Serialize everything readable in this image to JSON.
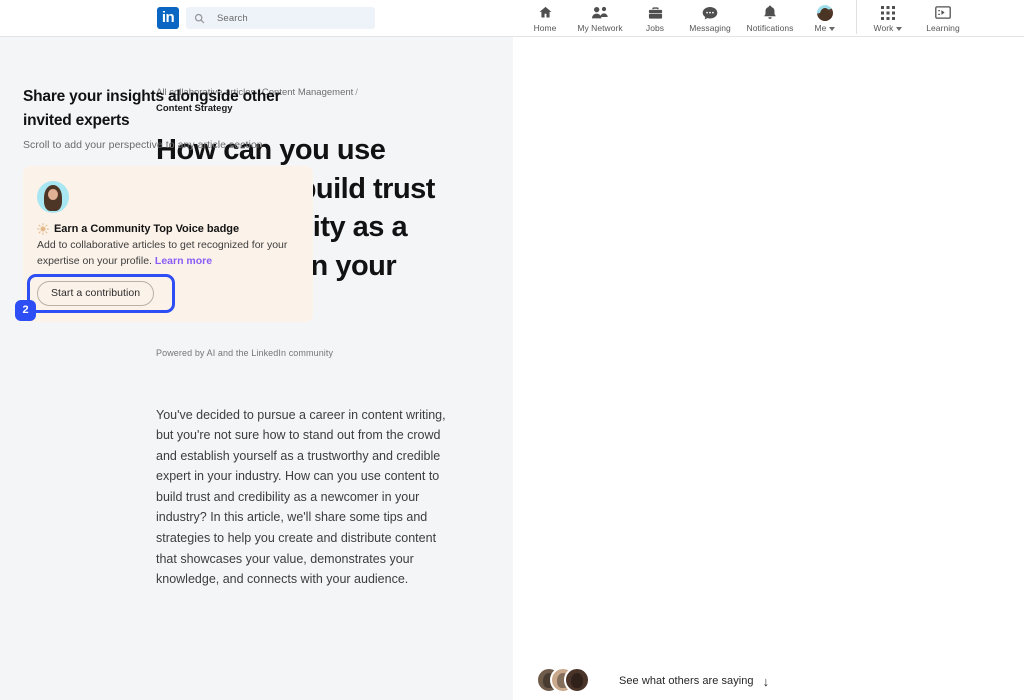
{
  "nav": {
    "logo": "in",
    "search_placeholder": "Search",
    "items": [
      {
        "label": "Home",
        "icon": "home-icon"
      },
      {
        "label": "My Network",
        "icon": "network-icon"
      },
      {
        "label": "Jobs",
        "icon": "briefcase-icon"
      },
      {
        "label": "Messaging",
        "icon": "message-icon"
      },
      {
        "label": "Notifications",
        "icon": "bell-icon"
      },
      {
        "label": "Me",
        "icon": "avatar-icon"
      }
    ],
    "right_items": [
      {
        "label": "Work",
        "icon": "grid-icon"
      },
      {
        "label": "Learning",
        "icon": "learning-icon"
      }
    ]
  },
  "article": {
    "breadcrumb": {
      "items": [
        "All collaborative articles",
        "Content Management"
      ],
      "separator": "/",
      "current": "Content Strategy"
    },
    "headline": "How can you use content to build trust and credibility as a newcomer in your industry?",
    "powered_by": "Powered by AI and the LinkedIn community",
    "body": "You've decided to pursue a career in content writing, but you're not sure how to stand out from the crowd and establish yourself as a trustworthy and credible expert in your industry. How can you use content to build trust and credibility as a newcomer in your industry? In this article, we'll share some tips and strategies to help you create and distribute content that showcases your value, demonstrates your knowledge, and connects with your audience."
  },
  "right_panel": {
    "title": "Share your insights alongside other invited experts",
    "subtitle": "Scroll to add your perspective to any article section",
    "promo": {
      "badge_icon": "sun-badge-icon",
      "badge_title": "Earn a Community Top Voice badge",
      "description": "Add to collaborative articles to get recognized for your expertise on your profile. ",
      "learn_more": "Learn more",
      "cta_label": "Start a contribution",
      "step_number": "2",
      "background_color": "#fbf2e9",
      "highlight_color": "#2d4df5",
      "link_color": "#8a5cf6"
    },
    "footer": {
      "see_more_label": "See what others are saying",
      "arrow": "↓"
    }
  },
  "theme": {
    "brand_color": "#0a66c2",
    "page_bg": "#f4f5f7",
    "panel_bg": "#ffffff"
  }
}
